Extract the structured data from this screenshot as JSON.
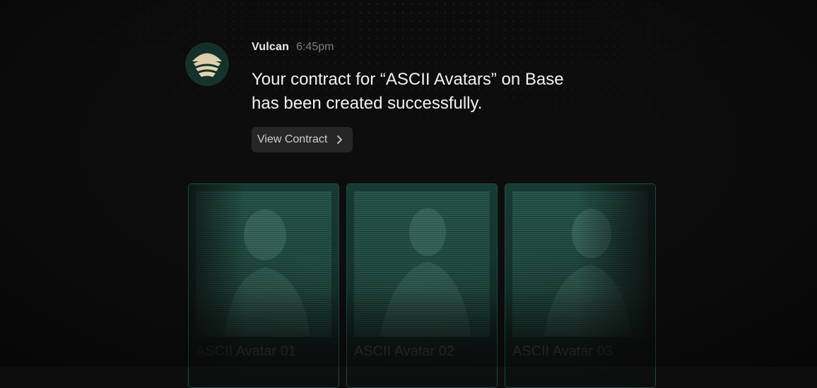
{
  "notification": {
    "sender": "Vulcan",
    "time": "6:45pm",
    "message": "Your contract for “ASCII Avatars” on Base has been created successfully.",
    "action_label": "View Contract",
    "avatar_icon": "vulcan-logo-icon",
    "action_icon": "chevron-right-icon"
  },
  "cards": [
    {
      "title": "ASCII Avatar 01"
    },
    {
      "title": "ASCII Avatar 02"
    },
    {
      "title": "ASCII Avatar 03"
    }
  ],
  "colors": {
    "background": "#0d0d0d",
    "avatar_bg": "#15332c",
    "logo": "#e8d9b5",
    "button_bg": "#262626",
    "card_border": "#1f4d42",
    "card_bg": "#173a32"
  }
}
